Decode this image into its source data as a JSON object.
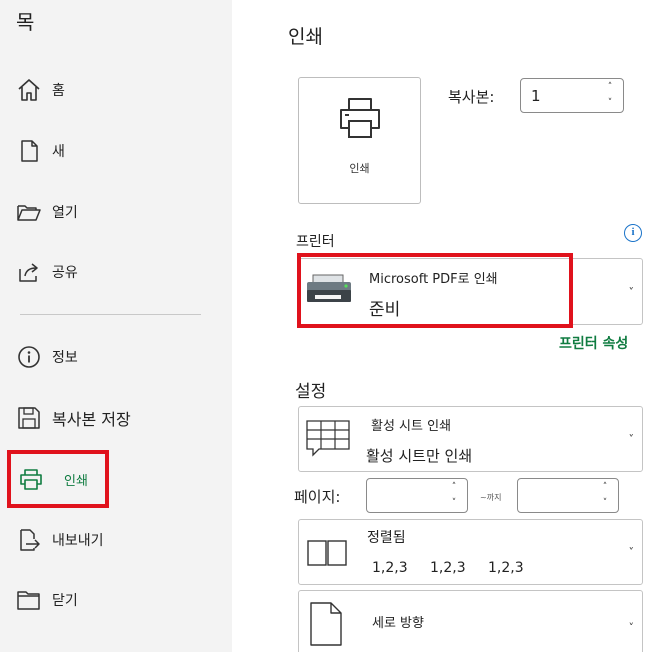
{
  "sidebar": {
    "title": "목",
    "items": [
      {
        "label": "홈",
        "icon": "home-icon"
      },
      {
        "label": "새",
        "icon": "new-document-icon"
      },
      {
        "label": "열기",
        "icon": "open-folder-icon"
      },
      {
        "label": "공유",
        "icon": "share-icon"
      },
      {
        "label": "정보",
        "icon": "info-icon"
      },
      {
        "label": "복사본 저장",
        "icon": "save-icon"
      },
      {
        "label": "인쇄",
        "icon": "printer-icon"
      },
      {
        "label": "내보내기",
        "icon": "export-icon"
      },
      {
        "label": "닫기",
        "icon": "close-folder-icon"
      }
    ]
  },
  "main": {
    "title": "인쇄",
    "print_button": {
      "label": "인쇄",
      "icon": "printer-icon"
    },
    "copies": {
      "label": "복사본:",
      "value": "1"
    },
    "printer": {
      "section_label": "프린터",
      "name": "Microsoft PDF로 인쇄",
      "status": "준비",
      "properties_link": "프린터 속성",
      "icon": "printer-device-icon",
      "info_icon": "i"
    },
    "settings": {
      "section_label": "설정",
      "scope": {
        "title": "활성 시트 인쇄",
        "value": "활성 시트만 인쇄",
        "icon": "sheet-grid-icon"
      },
      "pages": {
        "label": "페이지:",
        "from_value": "",
        "separator": "~까지",
        "to_value": ""
      },
      "collation": {
        "title": "정렬됨",
        "values": [
          "1,2,3",
          "1,2,3",
          "1,2,3"
        ],
        "icon": "collated-icon"
      },
      "orientation": {
        "title": "세로 방향",
        "icon": "portrait-page-icon"
      }
    }
  },
  "colors": {
    "accent": "#107c41",
    "highlight": "#e0121c",
    "info": "#1a73c9",
    "sidebar_bg": "#f3f3f3"
  }
}
